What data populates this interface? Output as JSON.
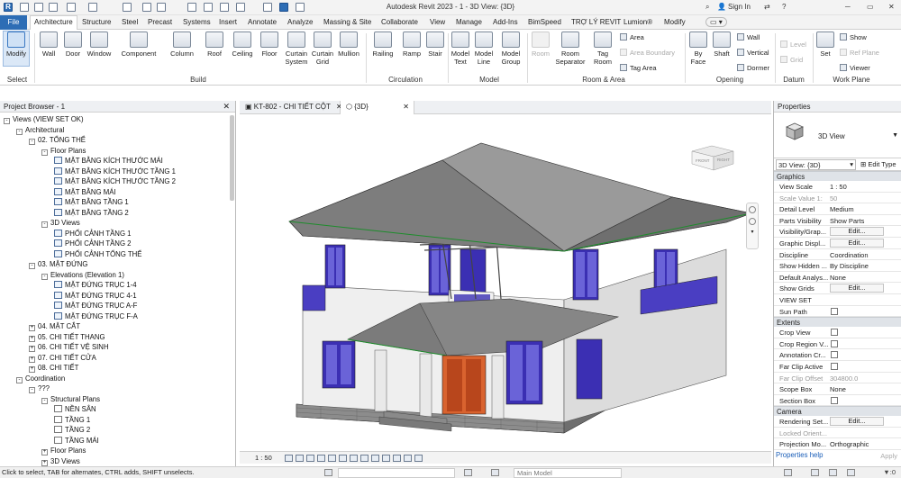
{
  "qat": {
    "title": "Autodesk Revit 2023 - 1 - 3D View: {3D}",
    "signin": "Sign In"
  },
  "tabs": [
    "File",
    "Architecture",
    "Structure",
    "Steel",
    "Precast",
    "Systems",
    "Insert",
    "Annotate",
    "Analyze",
    "Massing & Site",
    "Collaborate",
    "View",
    "Manage",
    "Add-Ins",
    "BimSpeed",
    "TRỢ LÝ REVIT",
    "Lumion®",
    "Modify"
  ],
  "ribbon": {
    "modify": "Modify",
    "select": "Select",
    "wall": "Wall",
    "door": "Door",
    "window": "Window",
    "component": "Component",
    "column": "Column",
    "roof": "Roof",
    "ceiling": "Ceiling",
    "floor": "Floor",
    "curtain_system": [
      "Curtain",
      "System"
    ],
    "curtain_grid": [
      "Curtain",
      "Grid"
    ],
    "mullion": "Mullion",
    "railing": "Railing",
    "ramp": "Ramp",
    "stair": "Stair",
    "model_text": [
      "Model",
      "Text"
    ],
    "model_line": [
      "Model",
      "Line"
    ],
    "model_group": [
      "Model",
      "Group"
    ],
    "room": "Room",
    "room_separator": [
      "Room",
      "Separator"
    ],
    "tag_room": [
      "Tag",
      "Room"
    ],
    "area": "Area",
    "area_boundary": "Area Boundary",
    "tag_area": "Tag Area",
    "by_face": [
      "By",
      "Face"
    ],
    "shaft": "Shaft",
    "wall_op": "Wall",
    "vertical": "Vertical",
    "dormer": "Dormer",
    "level": "Level",
    "grid": "Grid",
    "set": "Set",
    "show": "Show",
    "ref_plane": "Ref Plane",
    "viewer": "Viewer",
    "groups": {
      "select": "Select",
      "build": "Build",
      "circulation": "Circulation",
      "model": "Model",
      "room_area": "Room & Area",
      "opening": "Opening",
      "datum": "Datum",
      "work_plane": "Work Plane"
    }
  },
  "project_browser": {
    "title": "Project Browser - 1",
    "items": [
      {
        "t": "Views (VIEW SET OK)",
        "i": "-",
        "d": 0
      },
      {
        "t": "Architectural",
        "i": "-",
        "d": 1
      },
      {
        "t": "02. TỔNG THỂ",
        "i": "-",
        "d": 2
      },
      {
        "t": "Floor Plans",
        "i": "-",
        "d": 3
      },
      {
        "t": "MẶT BẰNG KÍCH THƯỚC MÁI",
        "d": 4,
        "v": 1
      },
      {
        "t": "MẶT BẰNG KÍCH THƯỚC TẦNG 1",
        "d": 4,
        "v": 1
      },
      {
        "t": "MẶT BẰNG KÍCH THƯỚC TẦNG 2",
        "d": 4,
        "v": 1
      },
      {
        "t": "MẶT BẰNG MÁI",
        "d": 4,
        "v": 1
      },
      {
        "t": "MẶT BẰNG TẦNG 1",
        "d": 4,
        "v": 1
      },
      {
        "t": "MẶT BẰNG TẦNG 2",
        "d": 4,
        "v": 1
      },
      {
        "t": "3D Views",
        "i": "-",
        "d": 3
      },
      {
        "t": "PHỐI CẢNH TẦNG 1",
        "d": 4,
        "v": 1
      },
      {
        "t": "PHỐI CẢNH TẦNG 2",
        "d": 4,
        "v": 1
      },
      {
        "t": "PHỐI CẢNH TỔNG THỂ",
        "d": 4,
        "v": 1
      },
      {
        "t": "03. MẶT ĐỨNG",
        "i": "-",
        "d": 2
      },
      {
        "t": "Elevations (Elevation 1)",
        "i": "-",
        "d": 3
      },
      {
        "t": "MẶT ĐỨNG TRỤC 1-4",
        "d": 4,
        "v": 1
      },
      {
        "t": "MẶT ĐỨNG TRỤC 4-1",
        "d": 4,
        "v": 1
      },
      {
        "t": "MẶT ĐỨNG TRỤC A-F",
        "d": 4,
        "v": 1
      },
      {
        "t": "MẶT ĐỨNG TRỤC F-A",
        "d": 4,
        "v": 1
      },
      {
        "t": "04. MẶT CẮT",
        "i": "+",
        "d": 2
      },
      {
        "t": "05. CHI TIẾT THANG",
        "i": "+",
        "d": 2
      },
      {
        "t": "06. CHI TIẾT VỆ SINH",
        "i": "+",
        "d": 2
      },
      {
        "t": "07. CHI TIẾT CỬA",
        "i": "+",
        "d": 2
      },
      {
        "t": "08. CHI TIẾT",
        "i": "+",
        "d": 2
      },
      {
        "t": "Coordination",
        "i": "-",
        "d": 1
      },
      {
        "t": "???",
        "i": "-",
        "d": 2
      },
      {
        "t": "Structural Plans",
        "i": "-",
        "d": 3
      },
      {
        "t": "NỀN SÂN",
        "d": 4,
        "v": 2
      },
      {
        "t": "TẦNG 1",
        "d": 4,
        "v": 2
      },
      {
        "t": "TẦNG 2",
        "d": 4,
        "v": 2
      },
      {
        "t": "TẦNG MÁI",
        "d": 4,
        "v": 2
      },
      {
        "t": "Floor Plans",
        "i": "+",
        "d": 3
      },
      {
        "t": "3D Views",
        "i": "+",
        "d": 3
      }
    ]
  },
  "view_tabs": [
    "KT-802 - CHI TIẾT CỘT",
    "{3D}"
  ],
  "view_bar": {
    "scale": "1 : 50"
  },
  "viewcube": {
    "front": "FRONT",
    "right": "RIGHT"
  },
  "properties": {
    "title": "Properties",
    "type_name": "3D View",
    "selector": "3D View: {3D}",
    "edit_type": "Edit Type",
    "groups": [
      {
        "name": "Graphics",
        "rows": [
          {
            "k": "View Scale",
            "v": "1 : 50"
          },
          {
            "k": "Scale Value  1:",
            "v": "50",
            "dis": true
          },
          {
            "k": "Detail Level",
            "v": "Medium"
          },
          {
            "k": "Parts Visibility",
            "v": "Show Parts"
          },
          {
            "k": "Visibility/Grap...",
            "b": "Edit..."
          },
          {
            "k": "Graphic Displ...",
            "b": "Edit..."
          },
          {
            "k": "Discipline",
            "v": "Coordination"
          },
          {
            "k": "Show Hidden ...",
            "v": "By Discipline"
          },
          {
            "k": "Default Analys...",
            "v": "None"
          },
          {
            "k": "Show Grids",
            "b": "Edit..."
          },
          {
            "k": "VIEW SET",
            "v": ""
          },
          {
            "k": "Sun Path",
            "c": true
          }
        ]
      },
      {
        "name": "Extents",
        "rows": [
          {
            "k": "Crop View",
            "c": true
          },
          {
            "k": "Crop Region V...",
            "c": true
          },
          {
            "k": "Annotation Cr...",
            "c": true
          },
          {
            "k": "Far Clip Active",
            "c": true
          },
          {
            "k": "Far Clip Offset",
            "v": "304800.0",
            "dis": true
          },
          {
            "k": "Scope Box",
            "v": "None"
          },
          {
            "k": "Section Box",
            "c": true
          }
        ]
      },
      {
        "name": "Camera",
        "rows": [
          {
            "k": "Rendering Set...",
            "b": "Edit..."
          },
          {
            "k": "Locked Orient...",
            "v": "",
            "dis": true
          },
          {
            "k": "Projection Mo...",
            "v": "Orthographic"
          }
        ]
      }
    ],
    "help": "Properties help",
    "apply": "Apply"
  },
  "status": {
    "text": "Click to select, TAB for alternates, CTRL adds, SHIFT unselects.",
    "model": "Main Model",
    "filter": ":0"
  }
}
